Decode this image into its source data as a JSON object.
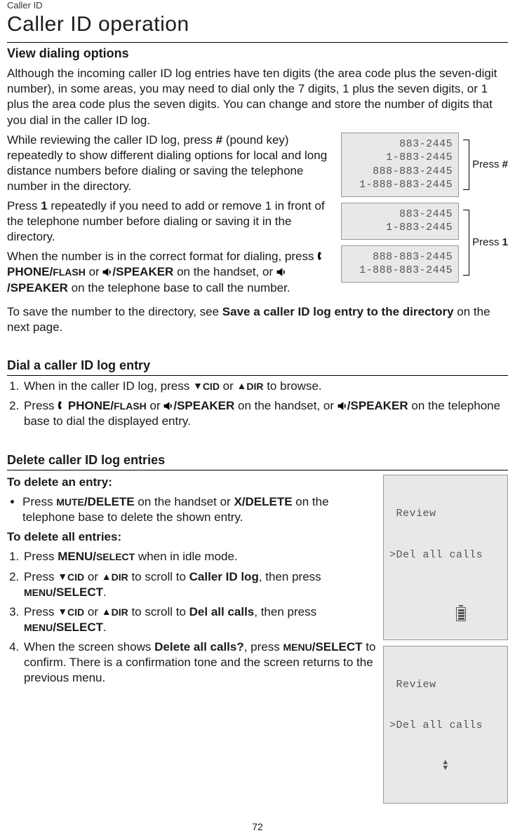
{
  "header": {
    "breadcrumb": "Caller ID",
    "title": "Caller ID operation"
  },
  "s1": {
    "heading": "View dialing options",
    "p1": "Although the incoming caller ID log entries have ten digits (the area code plus the seven-digit number), in some areas, you may need to dial only the 7 digits, 1 plus the seven digits, or 1 plus the area code plus the seven digits. You can change and store the number of digits that you dial in the caller ID log.",
    "p2a": "While reviewing the caller ID log, press ",
    "p2b": " (pound key) repeatedly to show different dialing options for local and long distance numbers before dialing or saving the telephone number in the directory.",
    "p2_key": "#",
    "p3a": "Press ",
    "p3_key": "1",
    "p3b": " repeatedly if you need to add or remove 1 in front of the telephone number before dialing or saving it in the directory.",
    "p4a": "When the number is in the correct format for dialing, press ",
    "p4_phone": "PHONE/",
    "p4_flash": "FLASH",
    "p4_or": " or ",
    "p4_speaker": "/SPEAKER",
    "p4b": " on the handset, or ",
    "p4c": " on the telephone base to call the number.",
    "p5a": "To save the number to the directory, see ",
    "p5_bold": "Save a caller ID log entry to the directory",
    "p5b": " on the next page.",
    "lcd1": "      883-2445\n    1-883-2445\n  888-883-2445\n1-888-883-2445",
    "lcd2": "      883-2445\n    1-883-2445",
    "lcd3": "  888-883-2445\n1-888-883-2445",
    "press_hash_a": "Press ",
    "press_hash_b": "#",
    "press_1_a": "Press ",
    "press_1_b": "1"
  },
  "s2": {
    "heading": "Dial a caller ID log entry",
    "li1a": "When in the caller ID log, press ",
    "cid": "CID",
    "dir": "DIR",
    "li1b": " or ",
    "li1c": " to browse.",
    "li2a": "Press ",
    "phone": "PHONE/",
    "flash": "FLASH",
    "or": " or ",
    "speaker": "/SPEAKER",
    "li2b": " on the handset, or ",
    "li2c": " on the telephone base to dial the displayed entry."
  },
  "s3": {
    "heading": "Delete caller ID log entries",
    "sub1": "To delete an entry:",
    "b1a": "Press ",
    "mute": "MUTE",
    "delete": "/DELETE",
    "b1b": " on the handset or ",
    "xdelete": "X/DELETE",
    "b1c": " on the telephone base to delete the shown entry.",
    "sub2": "To delete all entries:",
    "li1a": "Press ",
    "menu": "MENU/",
    "select": "SELECT",
    "li1b": " when in idle mode.",
    "li2a": "Press ",
    "cid": "CID",
    "dir": "DIR",
    "li2_or": " or ",
    "li2b": " to scroll to ",
    "li2_bold": "Caller ID log",
    "li2c": ", then press ",
    "menuselect": "MENU",
    "ms2": "/SELECT",
    "li2d": ".",
    "li3b": " to scroll to ",
    "li3_bold": "Del all calls",
    "li3c": ", then press ",
    "li4a": "When the screen shows ",
    "li4_bold": "Delete all calls?",
    "li4b": ", press ",
    "li4c": " to confirm. There is a confirmation tone and the screen returns to the previous menu.",
    "lcd1_l1": " Review",
    "lcd1_l2": ">Del all calls",
    "lcd2_l1": " Review",
    "lcd2_l2": ">Del all calls"
  },
  "page": "72"
}
